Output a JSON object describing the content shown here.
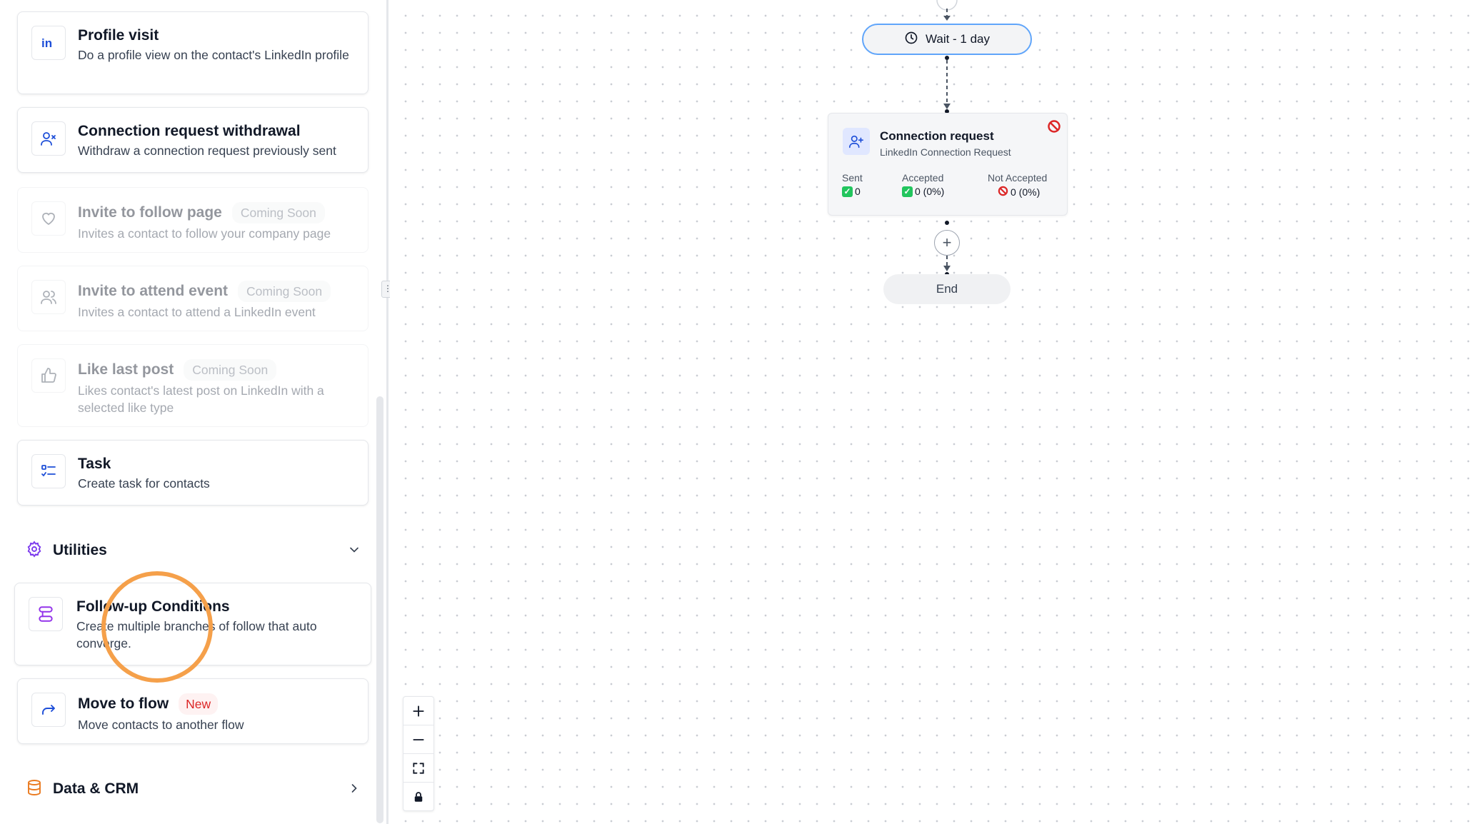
{
  "sidebar": {
    "cards": [
      {
        "title": "Profile visit",
        "desc": "Do a profile view on the contact's LinkedIn profile",
        "icon": "linkedin-icon"
      },
      {
        "title": "Connection request withdrawal",
        "desc": "Withdraw a connection request previously sent",
        "icon": "user-x-icon"
      },
      {
        "title": "Invite to follow page",
        "badge": "Coming Soon",
        "desc": "Invites a contact to follow your company page",
        "icon": "heart-icon"
      },
      {
        "title": "Invite to attend event",
        "badge": "Coming Soon",
        "desc": "Invites a contact to attend a LinkedIn event",
        "icon": "users-icon"
      },
      {
        "title": "Like last post",
        "badge": "Coming Soon",
        "desc": "Likes contact's latest post on LinkedIn with a selected like type",
        "icon": "thumbs-up-icon"
      },
      {
        "title": "Task",
        "desc": "Create task for contacts",
        "icon": "checklist-icon"
      }
    ],
    "utilities": {
      "label": "Utilities",
      "cards": [
        {
          "title": "Follow-up Conditions",
          "desc": "Create multiple branches of follow that auto converge.",
          "icon": "branch-icon"
        },
        {
          "title": "Move to flow",
          "badge": "New",
          "desc": "Move contacts to another flow",
          "icon": "forward-arrow-icon"
        }
      ]
    },
    "data_crm": {
      "label": "Data & CRM"
    }
  },
  "canvas": {
    "wait_label": "Wait - 1 day",
    "node": {
      "title": "Connection request",
      "subtitle": "LinkedIn Connection Request",
      "stats": [
        {
          "label": "Sent",
          "value": "0"
        },
        {
          "label": "Accepted",
          "value": "0 (0%)"
        },
        {
          "label": "Not Accepted",
          "value": "0 (0%)"
        }
      ]
    },
    "add_symbol": "+",
    "end_label": "End",
    "controls": [
      "zoom-in",
      "zoom-out",
      "fit-view",
      "lock"
    ]
  },
  "colors": {
    "accent_blue": "#60a5fa",
    "utilities_purple": "#7c3aed",
    "data_orange": "#ea7a1f",
    "highlight_ring": "#f5a04a",
    "success_green": "#22c55e",
    "danger_red": "#dc2626"
  }
}
